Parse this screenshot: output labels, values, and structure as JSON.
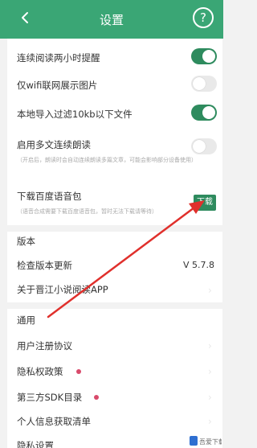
{
  "header": {
    "title": "设置",
    "back_icon": "chevron-left-icon",
    "help_label": "?"
  },
  "settings": {
    "reminder": "连续阅读两小时提醒",
    "wifi_images": "仅wifi联网展示图片",
    "filter_local": "本地导入过滤10kb以下文件",
    "multi_read": "启用多文连续朗读",
    "multi_read_desc": "（开启后，朗读时会自动连续朗读多篇文章，可能会影响部分设备使用）",
    "baidu_voice": "下载百度语音包",
    "baidu_voice_desc": "（语音合成需要下载百度语音包，暂时无法下载请等待）",
    "download_label": "下载"
  },
  "version_section": {
    "title": "版本",
    "check_update": "检查版本更新",
    "version_value": "V 5.7.8",
    "about": "关于晋江小说阅读APP"
  },
  "general_section": {
    "title": "通用",
    "user_agreement": "用户注册协议",
    "privacy_policy": "隐私权政策",
    "third_party_sdk": "第三方SDK目录",
    "personal_info": "个人信息获取清单",
    "privacy_settings": "隐私设置"
  },
  "toggles": {
    "reminder": true,
    "wifi_images": false,
    "filter_local": true,
    "multi_read": false
  },
  "watermark": "吾爱下载网",
  "colors": {
    "brand": "#3aa675",
    "toggle_on": "#2e8b5e",
    "arrow": "#e0302c",
    "dot": "#d84a6b"
  }
}
